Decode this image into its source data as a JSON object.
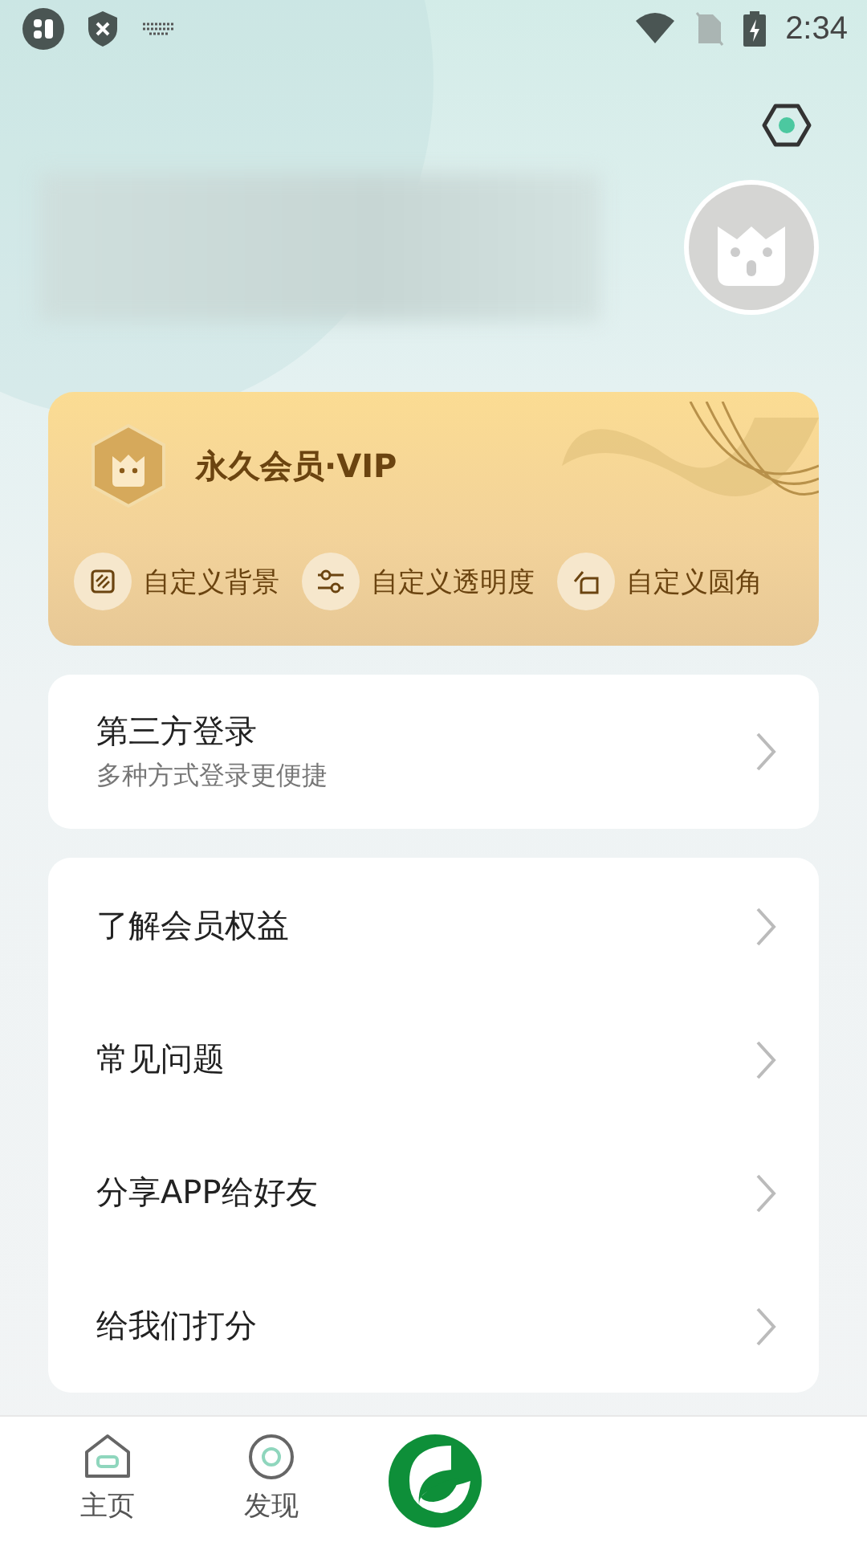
{
  "status_bar": {
    "time": "2:34"
  },
  "vip_card": {
    "title": "永久会员·VIP",
    "features": [
      {
        "kind": "background",
        "label": "自定义背景"
      },
      {
        "kind": "opacity",
        "label": "自定义透明度"
      },
      {
        "kind": "corner",
        "label": "自定义圆角"
      }
    ]
  },
  "login_card": {
    "title": "第三方登录",
    "subtitle": "多种方式登录更便捷"
  },
  "menu": [
    {
      "label": "了解会员权益"
    },
    {
      "label": "常见问题"
    },
    {
      "label": "分享APP给好友"
    },
    {
      "label": "给我们打分"
    }
  ],
  "tab_bar": [
    {
      "kind": "home",
      "label": "主页",
      "selected": false
    },
    {
      "kind": "discover",
      "label": "发现",
      "selected": false
    },
    {
      "kind": "logo",
      "selected": true
    }
  ]
}
